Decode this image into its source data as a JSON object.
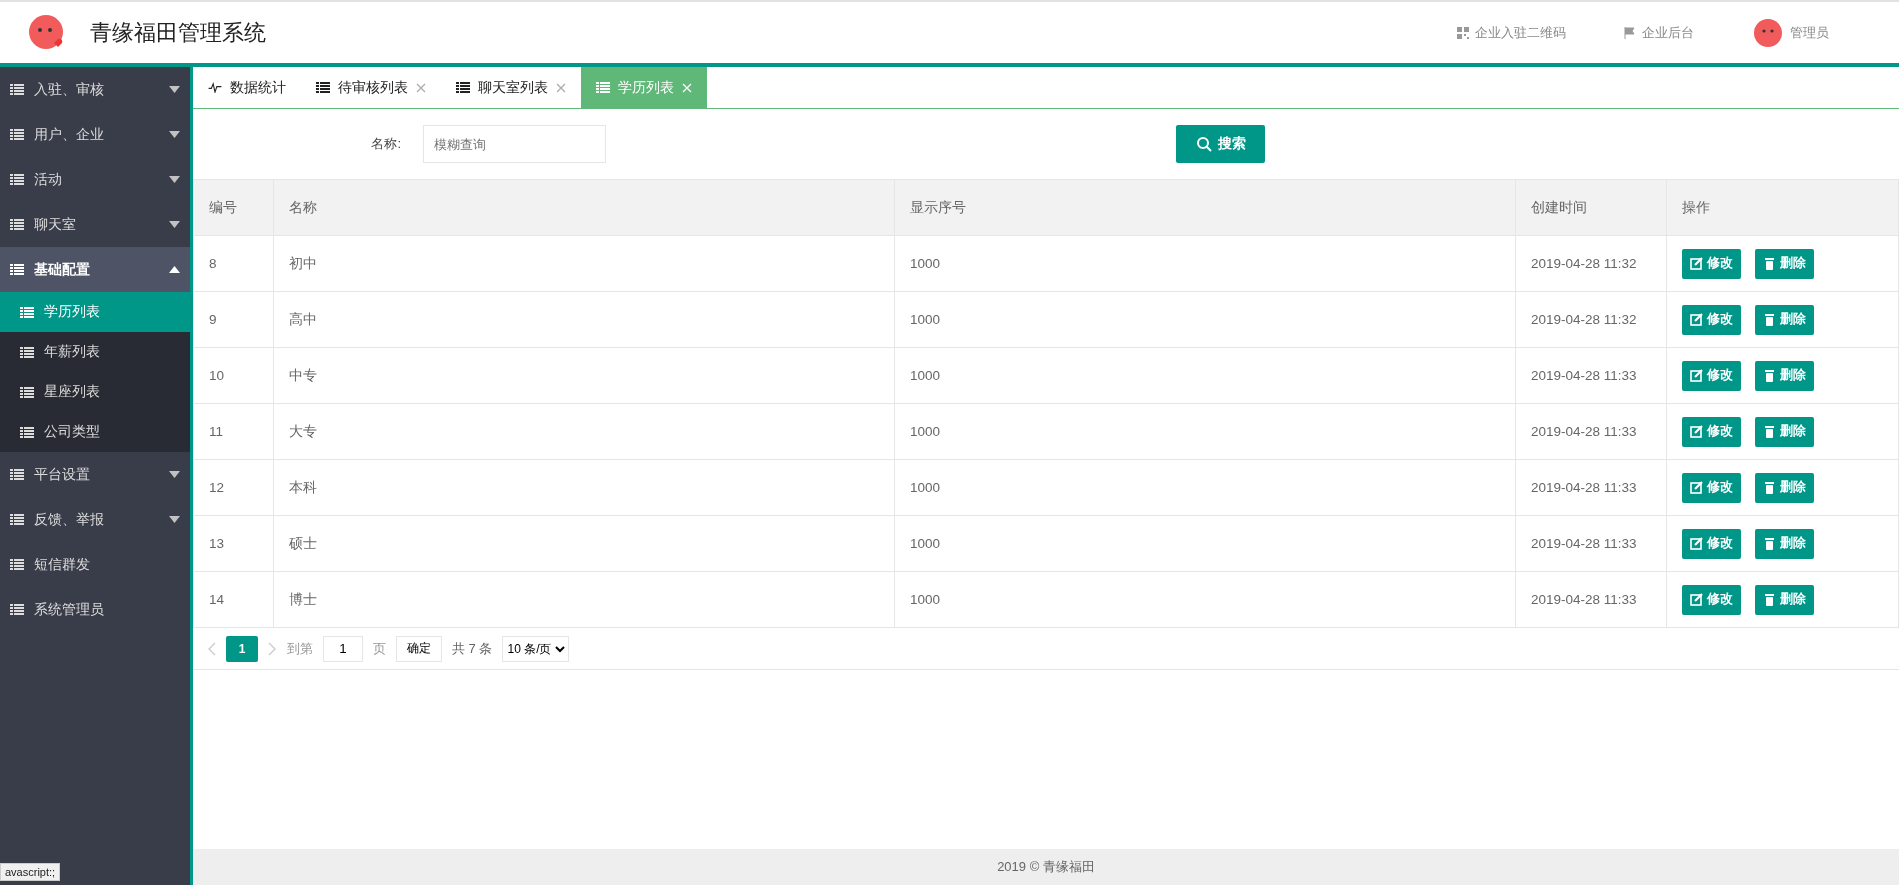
{
  "header": {
    "title": "青缘福田管理系统",
    "links": [
      {
        "label": "企业入驻二维码",
        "kind": "qrcode"
      },
      {
        "label": "企业后台",
        "kind": "flag"
      }
    ],
    "user": "管理员"
  },
  "sidebar": {
    "items": [
      {
        "label": "入驻、审核",
        "expanded": false,
        "has_children": true
      },
      {
        "label": "用户、企业",
        "expanded": false,
        "has_children": true
      },
      {
        "label": "活动",
        "expanded": false,
        "has_children": true
      },
      {
        "label": "聊天室",
        "expanded": false,
        "has_children": true
      },
      {
        "label": "基础配置",
        "expanded": true,
        "has_children": true,
        "children": [
          {
            "label": "学历列表",
            "selected": true
          },
          {
            "label": "年薪列表",
            "selected": false
          },
          {
            "label": "星座列表",
            "selected": false
          },
          {
            "label": "公司类型",
            "selected": false
          }
        ]
      },
      {
        "label": "平台设置",
        "expanded": false,
        "has_children": true
      },
      {
        "label": "反馈、举报",
        "expanded": false,
        "has_children": true
      },
      {
        "label": "短信群发",
        "expanded": false,
        "has_children": false
      },
      {
        "label": "系统管理员",
        "expanded": false,
        "has_children": false
      }
    ]
  },
  "tabs": [
    {
      "label": "数据统计",
      "kind": "chart",
      "closable": false,
      "selected": false
    },
    {
      "label": "待审核列表",
      "kind": "list",
      "closable": true,
      "selected": false
    },
    {
      "label": "聊天室列表",
      "kind": "list",
      "closable": true,
      "selected": false
    },
    {
      "label": "学历列表",
      "kind": "list",
      "closable": true,
      "selected": true
    }
  ],
  "search": {
    "label": "名称:",
    "placeholder": "模糊查询",
    "button": "搜索"
  },
  "table": {
    "columns": [
      "编号",
      "名称",
      "显示序号",
      "创建时间",
      "操作"
    ],
    "rows": [
      {
        "cells": [
          "8",
          "初中",
          "1000",
          "2019-04-28 11:32"
        ],
        "actions": [
          "修改",
          "删除"
        ]
      },
      {
        "cells": [
          "9",
          "高中",
          "1000",
          "2019-04-28 11:32"
        ],
        "actions": [
          "修改",
          "删除"
        ]
      },
      {
        "cells": [
          "10",
          "中专",
          "1000",
          "2019-04-28 11:33"
        ],
        "actions": [
          "修改",
          "删除"
        ]
      },
      {
        "cells": [
          "11",
          "大专",
          "1000",
          "2019-04-28 11:33"
        ],
        "actions": [
          "修改",
          "删除"
        ]
      },
      {
        "cells": [
          "12",
          "本科",
          "1000",
          "2019-04-28 11:33"
        ],
        "actions": [
          "修改",
          "删除"
        ]
      },
      {
        "cells": [
          "13",
          "硕士",
          "1000",
          "2019-04-28 11:33"
        ],
        "actions": [
          "修改",
          "删除"
        ]
      },
      {
        "cells": [
          "14",
          "博士",
          "1000",
          "2019-04-28 11:33"
        ],
        "actions": [
          "修改",
          "删除"
        ]
      }
    ]
  },
  "pagination": {
    "pages": [
      {
        "label": "1",
        "selected": true
      }
    ],
    "goto_label": "到第",
    "page_value": "1",
    "page_unit": "页",
    "confirm": "确定",
    "total": "共 7 条",
    "page_size": "10 条/页"
  },
  "footer": "2019 © 青缘福田",
  "status_tip": "avascript:;"
}
